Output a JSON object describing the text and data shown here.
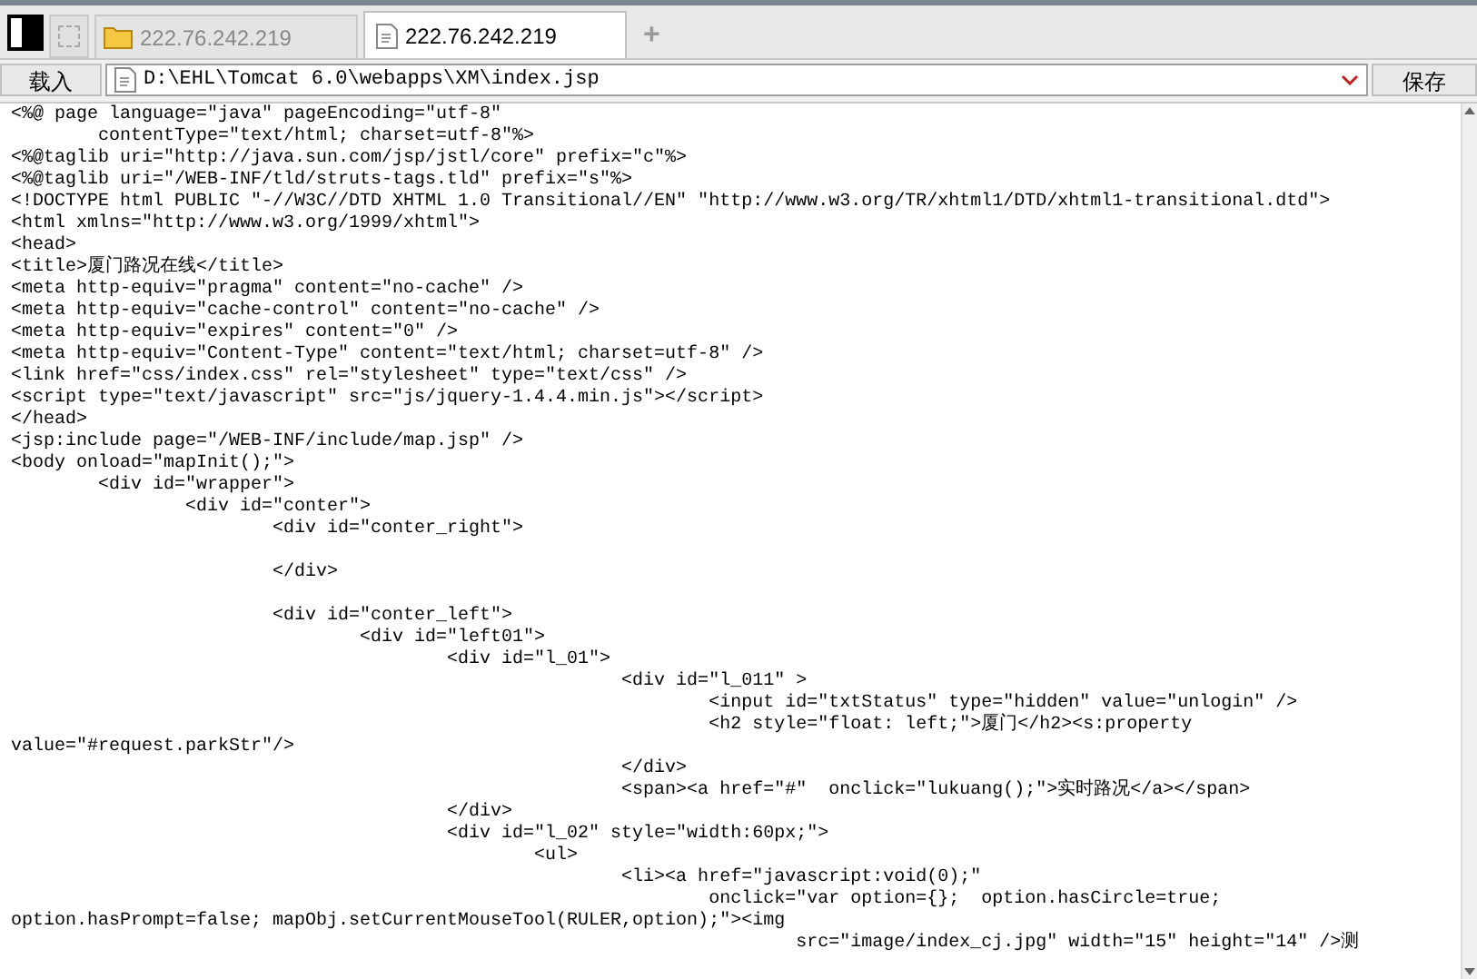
{
  "tabs": [
    {
      "label": "222.76.242.219",
      "kind": "folder",
      "selected": false
    },
    {
      "label": "222.76.242.219",
      "kind": "file",
      "selected": true
    }
  ],
  "new_tab_button": "+",
  "toolbar": {
    "load_button": "载入",
    "path": "D:\\EHL\\Tomcat 6.0\\webapps\\XM\\index.jsp",
    "save_button": "保存"
  },
  "code_blocks": [
    [
      "<%@ page language=\"java\" pageEncoding=\"utf-8\"",
      "        contentType=\"text/html; charset=utf-8\"%>",
      "<%@taglib uri=\"http://java.sun.com/jsp/jstl/core\" prefix=\"c\"%>",
      "<%@taglib uri=\"/WEB-INF/tld/struts-tags.tld\" prefix=\"s\"%>",
      "<!DOCTYPE html PUBLIC \"-//W3C//DTD XHTML 1.0 Transitional//EN\" \"http://www.w3.org/TR/xhtml1/DTD/xhtml1-transitional.dtd\">",
      "<html xmlns=\"http://www.w3.org/1999/xhtml\">",
      "<head>",
      "<title>厦门路况在线</title>",
      "<meta http-equiv=\"pragma\" content=\"no-cache\" />",
      "<meta http-equiv=\"cache-control\" content=\"no-cache\" />",
      "<meta http-equiv=\"expires\" content=\"0\" />",
      "<meta http-equiv=\"Content-Type\" content=\"text/html; charset=utf-8\" />",
      "<link href=\"css/index.css\" rel=\"stylesheet\" type=\"text/css\" />",
      "<script type=\"text/javascript\" src=\"js/jquery-1.4.4.min.js\"></script>",
      "</head>",
      "<jsp:include page=\"/WEB-INF/include/map.jsp\" />",
      "<body onload=\"mapInit();\">",
      "        <div id=\"wrapper\">",
      "                <div id=\"conter\">",
      "                        <div id=\"conter_right\">"
    ],
    [
      "                        </div>"
    ],
    [
      "                        <div id=\"conter_left\">",
      "                                <div id=\"left01\">",
      "                                        <div id=\"l_01\">",
      "                                                        <div id=\"l_011\" >",
      "                                                                <input id=\"txtStatus\" type=\"hidden\" value=\"unlogin\" />",
      "                                                                <h2 style=\"float: left;\">厦门</h2><s:property",
      "value=\"#request.parkStr\"/>",
      "                                                        </div>",
      "                                                        <span><a href=\"#\"  onclick=\"lukuang();\">实时路况</a></span>",
      "                                        </div>",
      "                                        <div id=\"l_02\" style=\"width:60px;\">",
      "                                                <ul>",
      "                                                        <li><a href=\"javascript:void(0);\"",
      "                                                                onclick=\"var option={};  option.hasCircle=true;",
      "option.hasPrompt=false; mapObj.setCurrentMouseTool(RULER,option);\"><img",
      "                                                                        src=\"image/index_cj.jpg\" width=\"15\" height=\"14\" />测"
    ]
  ]
}
